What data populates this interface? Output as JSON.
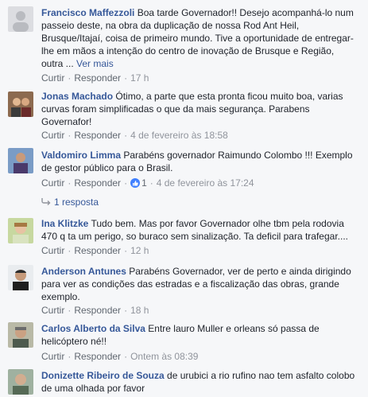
{
  "comments": [
    {
      "author": "Francisco Maffezzoli",
      "text": " Boa tarde Governador!! Desejo acompanhá-lo num passeio deste, na obra da duplicação de nossa Rod Ant Heil, Brusque/Itajaí, coisa de primeiro mundo. Tive a oportunidade de entregar-lhe em mãos a intenção do centro de inovação de Brusque e Região, outra ... ",
      "more": "Ver mais",
      "like": "Curtir",
      "reply": "Responder",
      "time": "17 h"
    },
    {
      "author": "Jonas Machado",
      "text": " Ótimo, a parte que esta pronta ficou muito boa, varias curvas foram simplificadas o que da mais segurança. Parabens Governafor!",
      "like": "Curtir",
      "reply": "Responder",
      "time": "4 de fevereiro às 18:58"
    },
    {
      "author": "Valdomiro Limma",
      "text": " Parabéns governador Raimundo Colombo !!! Exemplo de gestor público para o Brasil.",
      "like": "Curtir",
      "reply": "Responder",
      "reactions": "1",
      "time": "4 de fevereiro às 17:24",
      "replies_label": "1 resposta"
    },
    {
      "author": "Ina Klitzke",
      "text": " Tudo bem. Mas por favor Governador olhe tbm pela rodovia 470 q ta um perigo, so buraco sem sinalização. Ta deficil para trafegar....",
      "like": "Curtir",
      "reply": "Responder",
      "time": "12 h"
    },
    {
      "author": "Anderson Antunes",
      "text": " Parabéns Governador, ver de perto e ainda dirigindo para ver as condições das estradas e a fiscalização das obras, grande exemplo.",
      "like": "Curtir",
      "reply": "Responder",
      "time": "18 h"
    },
    {
      "author": "Carlos Alberto da Silva",
      "text": " Entre lauro Muller e orleans só passa de helicóptero né!!",
      "like": "Curtir",
      "reply": "Responder",
      "time": "Ontem às 08:39"
    },
    {
      "author": "Donizette Ribeiro de Souza",
      "text": " de urubici a rio rufino nao tem asfalto colobo de uma olhada por favor"
    }
  ],
  "colors": {
    "author": "#365899",
    "text": "#1d2129",
    "meta": "#90949c",
    "like_badge": "#4080ff",
    "background": "#f6f7f9"
  }
}
